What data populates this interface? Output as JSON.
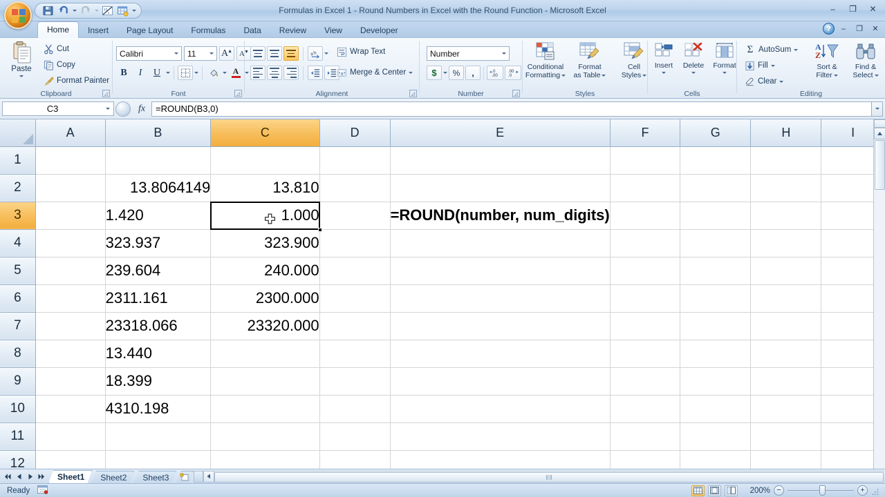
{
  "window": {
    "title": "Formulas in Excel 1 - Round Numbers in Excel with the Round Function - Microsoft Excel",
    "minimize": "–",
    "restore": "❐",
    "close": "✕"
  },
  "quick_access": {
    "items": [
      {
        "name": "save-icon",
        "label": "Save"
      },
      {
        "name": "undo-icon",
        "label": "Undo"
      },
      {
        "name": "redo-icon",
        "label": "Redo"
      },
      {
        "name": "formula-tools-icon",
        "label": "Formula Tools"
      },
      {
        "name": "spreadsheet-icon",
        "label": "Spreadsheet"
      },
      {
        "name": "customize-qat-icon",
        "label": "Customize Quick Access Toolbar"
      }
    ]
  },
  "ribbon": {
    "tabs": [
      {
        "label": "Home",
        "active": true
      },
      {
        "label": "Insert",
        "active": false
      },
      {
        "label": "Page Layout",
        "active": false
      },
      {
        "label": "Formulas",
        "active": false
      },
      {
        "label": "Data",
        "active": false
      },
      {
        "label": "Review",
        "active": false
      },
      {
        "label": "View",
        "active": false
      },
      {
        "label": "Developer",
        "active": false
      }
    ],
    "help_label": "?",
    "groups": {
      "clipboard": {
        "label": "Clipboard",
        "paste": "Paste",
        "cut": "Cut",
        "copy": "Copy",
        "format_painter": "Format Painter"
      },
      "font": {
        "label": "Font",
        "font_name": "Calibri",
        "font_size": "11",
        "grow_font": "A",
        "shrink_font": "A",
        "bold": "B",
        "italic": "I",
        "underline": "U"
      },
      "alignment": {
        "label": "Alignment",
        "wrap_text": "Wrap Text",
        "merge_center": "Merge & Center"
      },
      "number": {
        "label": "Number",
        "format": "Number",
        "currency": "$",
        "percent": "%",
        "comma": ",",
        "increase_decimal": ".00",
        "decrease_decimal": ".0"
      },
      "styles": {
        "label": "Styles",
        "conditional_formatting": "Conditional\nFormatting",
        "conditional_formatting_l1": "Conditional",
        "conditional_formatting_l2": "Formatting",
        "format_as_table_l1": "Format",
        "format_as_table_l2": "as Table",
        "cell_styles_l1": "Cell",
        "cell_styles_l2": "Styles"
      },
      "cells": {
        "label": "Cells",
        "insert": "Insert",
        "delete": "Delete",
        "format": "Format"
      },
      "editing": {
        "label": "Editing",
        "autosum": "AutoSum",
        "fill": "Fill",
        "clear": "Clear",
        "sort_filter_l1": "Sort &",
        "sort_filter_l2": "Filter",
        "find_select_l1": "Find &",
        "find_select_l2": "Select"
      }
    }
  },
  "formula_bar": {
    "name_box": "C3",
    "fx_label": "fx",
    "formula": "=ROUND(B3,0)"
  },
  "grid": {
    "columns": [
      "A",
      "B",
      "C",
      "D",
      "E",
      "F",
      "G",
      "H",
      "I"
    ],
    "selected_column": "C",
    "selected_row": "3",
    "selected_cell": "C3",
    "rows": [
      {
        "n": "1",
        "A": "",
        "B": "",
        "C": "",
        "E": ""
      },
      {
        "n": "2",
        "A": "",
        "B": "13.8064149",
        "C": "13.810",
        "E": ""
      },
      {
        "n": "3",
        "A": "",
        "B": "1.420",
        "C": "1.000",
        "E": "=ROUND(number, num_digits)"
      },
      {
        "n": "4",
        "A": "",
        "B": "323.937",
        "C": "323.900",
        "E": ""
      },
      {
        "n": "5",
        "A": "",
        "B": "239.604",
        "C": "240.000",
        "E": ""
      },
      {
        "n": "6",
        "A": "",
        "B": "2311.161",
        "C": "2300.000",
        "E": ""
      },
      {
        "n": "7",
        "A": "",
        "B": "23318.066",
        "C": "23320.000",
        "E": ""
      },
      {
        "n": "8",
        "A": "",
        "B": "13.440",
        "C": "",
        "E": ""
      },
      {
        "n": "9",
        "A": "",
        "B": "18.399",
        "C": "",
        "E": ""
      },
      {
        "n": "10",
        "A": "",
        "B": "4310.198",
        "C": "",
        "E": ""
      },
      {
        "n": "11",
        "A": "",
        "B": "",
        "C": "",
        "E": ""
      },
      {
        "n": "12",
        "A": "",
        "B": "",
        "C": "",
        "E": ""
      }
    ]
  },
  "sheet_tabs": {
    "tabs": [
      {
        "label": "Sheet1",
        "active": true
      },
      {
        "label": "Sheet2",
        "active": false
      },
      {
        "label": "Sheet3",
        "active": false
      }
    ],
    "insert_sheet": "Insert Worksheet",
    "nav": {
      "first": "◀│",
      "prev": "◀",
      "next": "▶",
      "last": "│▶"
    }
  },
  "status_bar": {
    "status": "Ready",
    "zoom": "200%",
    "views": [
      {
        "name": "normal-view",
        "active": true
      },
      {
        "name": "page-layout-view",
        "active": false
      },
      {
        "name": "page-break-view",
        "active": false
      }
    ],
    "zoom_out": "−",
    "zoom_in": "+"
  },
  "colors": {
    "accent_orange": "#f3ae3d",
    "header_blue": "#b8cce4",
    "selection_black": "#000000"
  }
}
